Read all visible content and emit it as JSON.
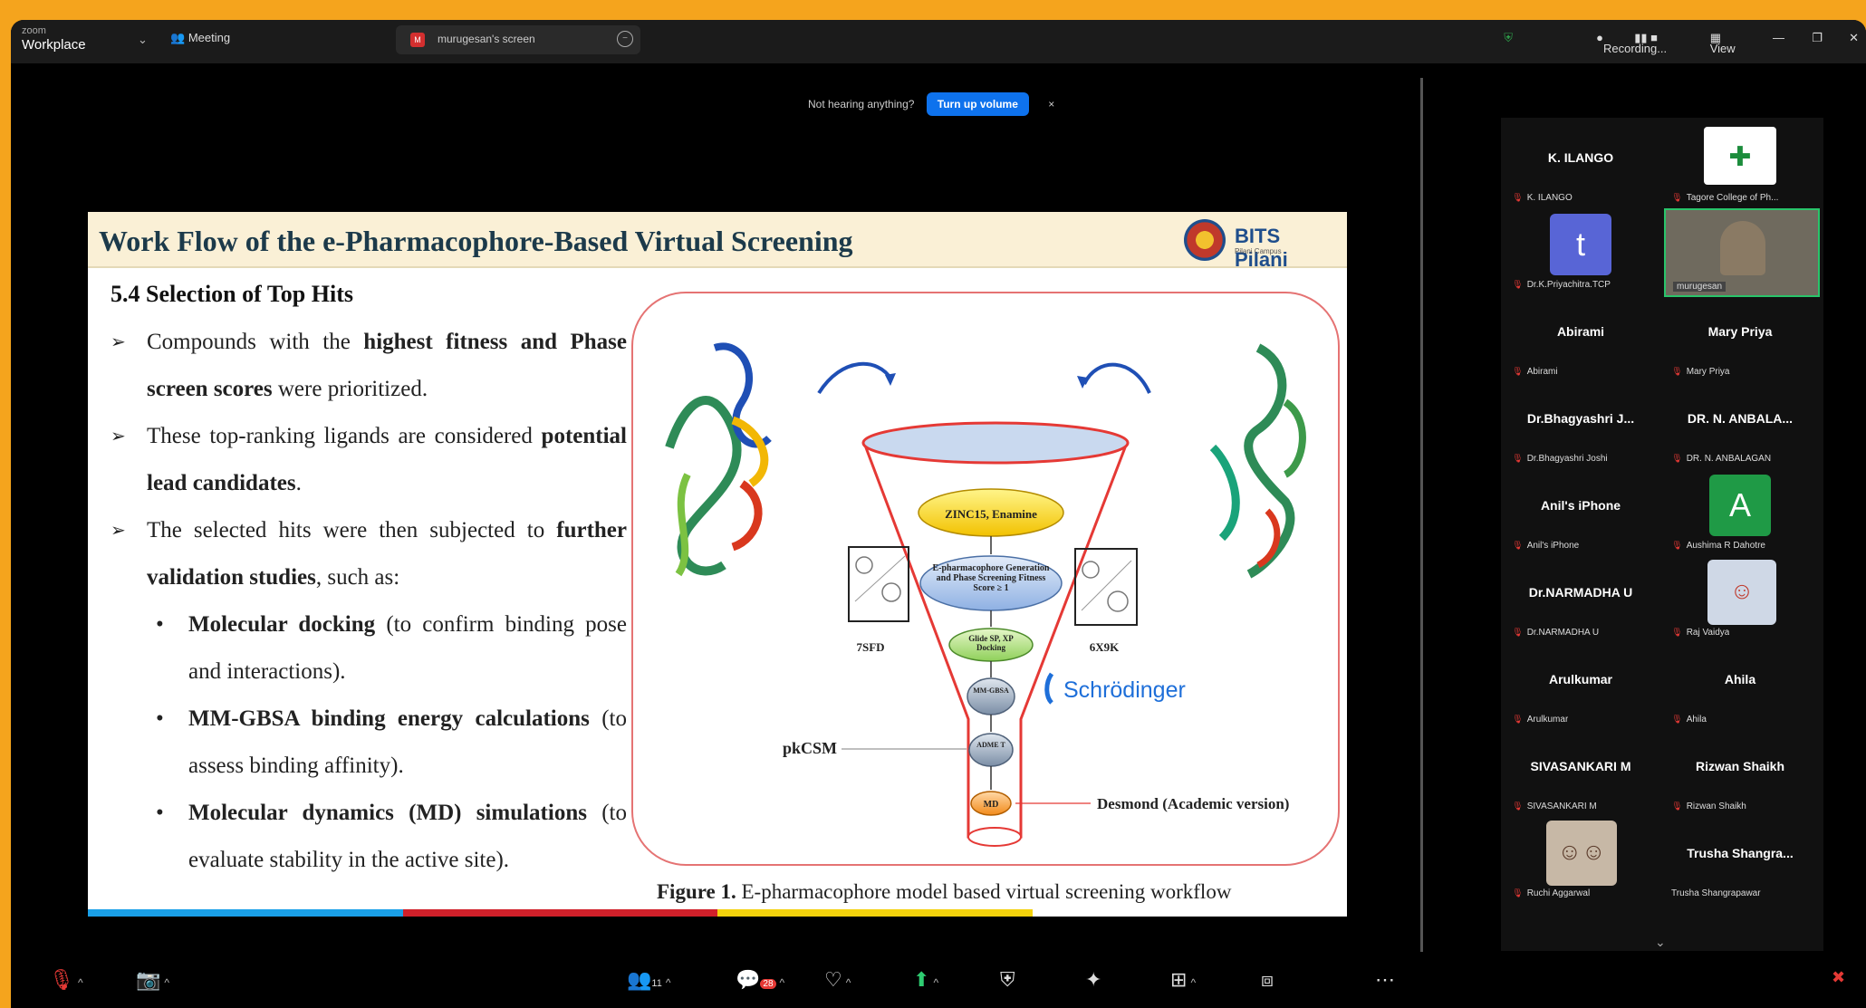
{
  "app": {
    "brand_top": "zoom",
    "brand_name": "Workplace",
    "meeting_label": "Meeting",
    "share_tab": "murugesan's screen"
  },
  "top_right": {
    "recording": "Recording...",
    "view": "View"
  },
  "notice": {
    "text": "Not hearing anything?",
    "button": "Turn up volume",
    "close": "×"
  },
  "slide": {
    "title": "Work Flow of the e-Pharmacophore-Based Virtual Screening",
    "logo_name": "BITS Pilani",
    "logo_sub": "Pilani Campus",
    "section": "5.4 Selection of Top Hits",
    "bullet1_pre": "Compounds with the ",
    "bullet1_bold": "highest fitness and Phase screen scores",
    "bullet1_post": " were prioritized.",
    "bullet2_pre": "These top-ranking ligands are considered ",
    "bullet2_bold": "potential lead candidates",
    "bullet2_post": ".",
    "bullet3_pre": "The selected hits were then subjected to ",
    "bullet3_bold": "further validation studies",
    "bullet3_post": ", such as:",
    "sub1_bold": "Molecular docking",
    "sub1_rest": " (to confirm binding pose and interactions).",
    "sub2_bold": "MM-GBSA binding energy calculations",
    "sub2_rest": " (to assess binding affinity).",
    "sub3_bold": "Molecular dynamics (MD) simulations",
    "sub3_rest": " (to evaluate stability in the active site).",
    "caption_bold": "Figure 1.",
    "caption_rest": " E-pharmacophore model based virtual screening workflow"
  },
  "figure": {
    "db": "ZINC15, Enamine",
    "step1": "E-pharmacophore Generation and Phase Screening Fitness Score ≥ 1",
    "step2": "Glide SP, XP Docking",
    "step3": "MM-GBSA",
    "step4": "ADME T",
    "step5": "MD",
    "left_pdb": "7SFD",
    "right_pdb": "6X9K",
    "software": "Schrödinger",
    "pkcsm": "pkCSM",
    "desmond": "Desmond (Academic version)"
  },
  "participants": [
    {
      "name": "K. ILANGO",
      "label": "K. ILANGO"
    },
    {
      "name": "",
      "label": "Tagore College of Ph..."
    },
    {
      "name": "",
      "label": "Dr.K.Priyachitra.TCP",
      "initial": "t"
    },
    {
      "name": "",
      "label": "murugesan"
    },
    {
      "name": "Abirami",
      "label": "Abirami"
    },
    {
      "name": "Mary Priya",
      "label": "Mary Priya"
    },
    {
      "name": "Dr.Bhagyashri J...",
      "label": "Dr.Bhagyashri Joshi"
    },
    {
      "name": "DR. N. ANBALA...",
      "label": "DR. N. ANBALAGAN"
    },
    {
      "name": "Anil's iPhone",
      "label": "Anil's iPhone"
    },
    {
      "name": "",
      "label": "Aushima R Dahotre",
      "initial": "A"
    },
    {
      "name": "Dr.NARMADHA U",
      "label": "Dr.NARMADHA U"
    },
    {
      "name": "",
      "label": "Raj Vaidya"
    },
    {
      "name": "Arulkumar",
      "label": "Arulkumar"
    },
    {
      "name": "Ahila",
      "label": "Ahila"
    },
    {
      "name": "SIVASANKARI M",
      "label": "SIVASANKARI M"
    },
    {
      "name": "Rizwan Shaikh",
      "label": "Rizwan Shaikh"
    },
    {
      "name": "",
      "label": "Ruchi Aggarwal"
    },
    {
      "name": "Trusha Shangra...",
      "label": "Trusha Shangrapawar"
    }
  ],
  "toolbar": {
    "participants_count": "11",
    "chat_badge": "28"
  },
  "colors": {
    "frame": "#f5a41d",
    "turnup": "#0e72ed",
    "bar_blue": "#1aa0e8",
    "bar_red": "#d0202a",
    "bar_yellow": "#f4d20c"
  }
}
